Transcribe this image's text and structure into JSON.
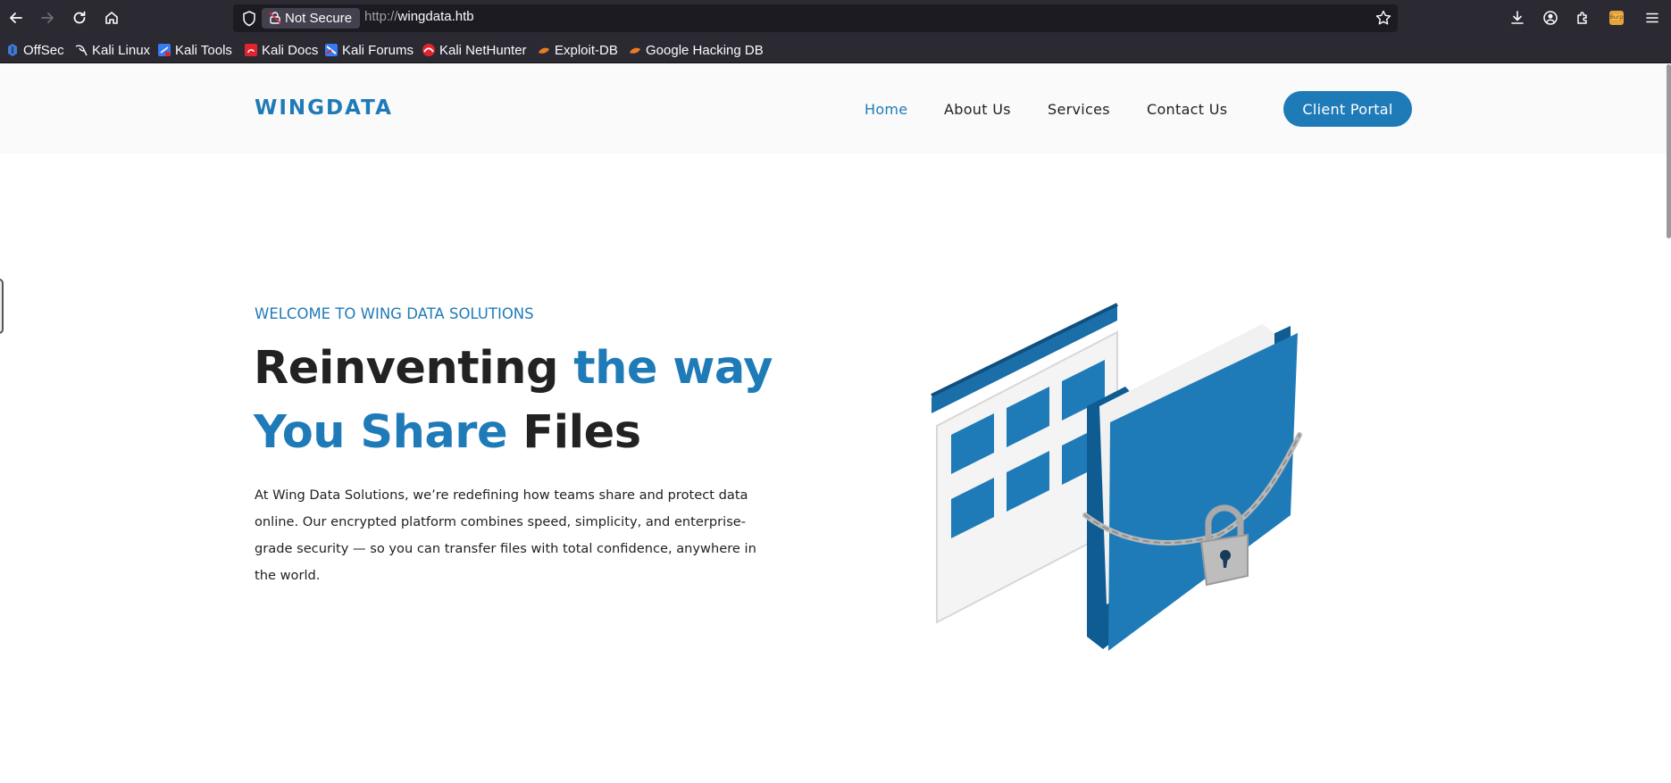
{
  "browser": {
    "nav": {
      "back_icon": "arrow-left-icon",
      "forward_icon": "arrow-right-icon",
      "reload_icon": "reload-icon",
      "home_icon": "home-icon"
    },
    "urlbar": {
      "security_label": "Not Secure",
      "scheme": "http://",
      "host": "wingdata.htb"
    },
    "bookmarks": [
      {
        "label": "OffSec",
        "icon": "offsec-icon"
      },
      {
        "label": "Kali Linux",
        "icon": "kali-dragon-icon"
      },
      {
        "label": "Kali Tools",
        "icon": "kali-tools-icon"
      },
      {
        "label": "Kali Docs",
        "icon": "kali-docs-icon"
      },
      {
        "label": "Kali Forums",
        "icon": "kali-forums-icon"
      },
      {
        "label": "Kali NetHunter",
        "icon": "nethunter-icon"
      },
      {
        "label": "Exploit-DB",
        "icon": "exploit-db-icon"
      },
      {
        "label": "Google Hacking DB",
        "icon": "ghdb-icon"
      }
    ],
    "colors": {
      "chrome": "#2b2a33",
      "urlbar": "#1c1b22",
      "text": "#fbfbfe"
    }
  },
  "site": {
    "brand": "WINGDATA",
    "nav": [
      {
        "label": "Home",
        "active": true
      },
      {
        "label": "About Us",
        "active": false
      },
      {
        "label": "Services",
        "active": false
      },
      {
        "label": "Contact Us",
        "active": false
      }
    ],
    "cta": "Client Portal",
    "hero": {
      "eyebrow": "WELCOME TO WING DATA SOLUTIONS",
      "headline": {
        "part1": "Reinventing ",
        "part2": "the way",
        "part3": "You Share",
        "part4": " Files"
      },
      "body": "At Wing Data Solutions, we’re redefining how teams share and protect data online. Our encrypted platform combines speed, simplicity, and enterprise-grade security — so you can transfer files with total confidence, anywhere in the world.",
      "illustration": "locked-folder-illustration"
    },
    "colors": {
      "accent": "#1f7bb8",
      "text": "#222222",
      "header_bg": "#fafafa"
    }
  }
}
